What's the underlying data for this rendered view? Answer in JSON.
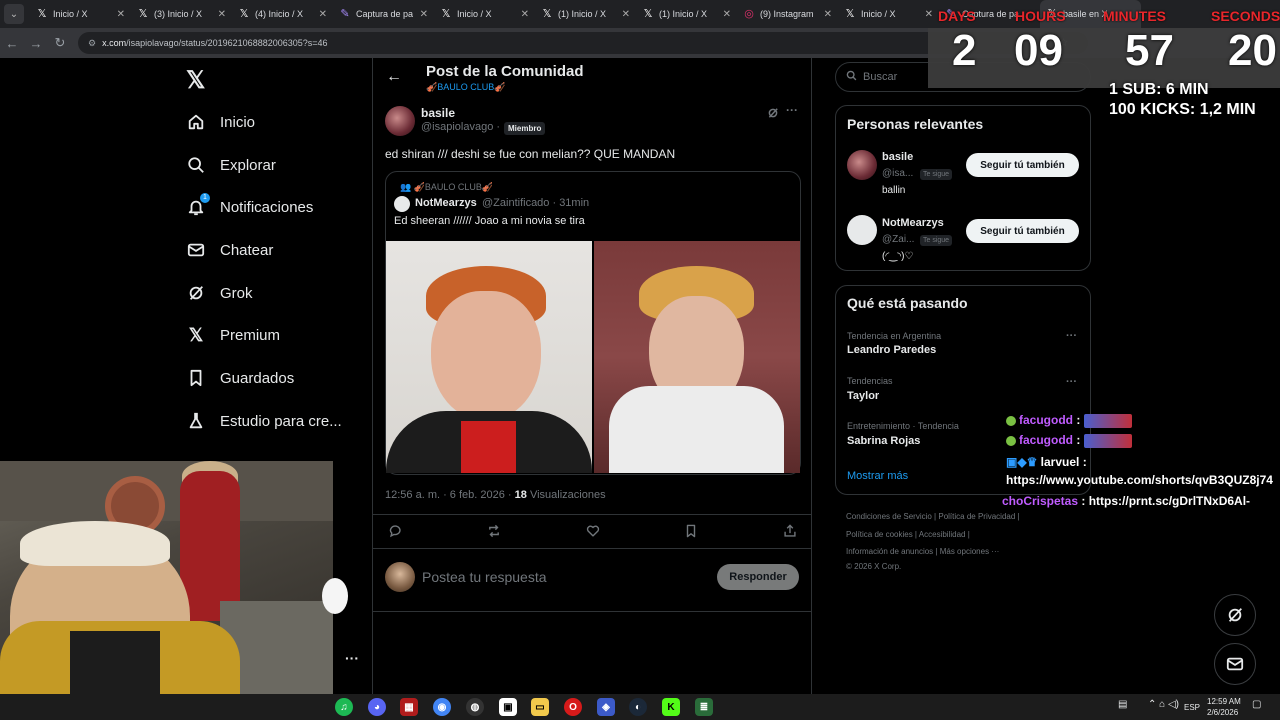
{
  "browser": {
    "tabs": [
      {
        "title": "Inicio / X",
        "icon": "x-icon"
      },
      {
        "title": "(3) Inicio / X",
        "icon": "x-icon"
      },
      {
        "title": "(4) Inicio / X",
        "icon": "x-icon"
      },
      {
        "title": "Captura de pa",
        "icon": "pen-icon"
      },
      {
        "title": "Inicio / X",
        "icon": "x-icon"
      },
      {
        "title": "(1) Inicio / X",
        "icon": "x-icon"
      },
      {
        "title": "(1) Inicio / X",
        "icon": "x-icon"
      },
      {
        "title": "(9) Instagram",
        "icon": "instagram-icon"
      },
      {
        "title": "Inicio / X",
        "icon": "x-icon"
      },
      {
        "title": "Captura de pa",
        "icon": "pen-icon"
      },
      {
        "title": "basile en X",
        "icon": "x-icon"
      }
    ],
    "url_host": "x.com",
    "url_path": "/isapiolavago/status/2019621068882006305?s=46"
  },
  "nav": {
    "items": [
      {
        "label": "Inicio",
        "icon": "home-icon"
      },
      {
        "label": "Explorar",
        "icon": "search-icon"
      },
      {
        "label": "Notificaciones",
        "icon": "bell-icon",
        "badge": "1"
      },
      {
        "label": "Chatear",
        "icon": "mail-icon"
      },
      {
        "label": "Grok",
        "icon": "grok-icon"
      },
      {
        "label": "Premium",
        "icon": "x-icon"
      },
      {
        "label": "Guardados",
        "icon": "bookmark-icon"
      },
      {
        "label": "Estudio para cre...",
        "icon": "studio-icon"
      }
    ],
    "more": "···"
  },
  "post": {
    "header_title": "Post de la Comunidad",
    "community": "🎻BAULO CLUB🎻",
    "author_name": "basile",
    "author_handle": "@isapiolavago",
    "member_tag": "Miembro",
    "text": "ed shiran /// deshi se fue con melian?? QUE MANDAN",
    "quote": {
      "community": "👥 🎻BAULO CLUB🎻",
      "name": "NotMearzys",
      "handle": "@Zaintificado · 31min",
      "text": "Ed sheeran  //////  Joao a mi novia se tira"
    },
    "time": "12:56 a. m. · 6 feb. 2026 · ",
    "views_count": "18",
    "views_label": " Visualizaciones",
    "reply_placeholder": "Postea tu respuesta",
    "reply_button": "Responder"
  },
  "sidebar": {
    "search_placeholder": "Buscar",
    "relevant_title": "Personas relevantes",
    "people": [
      {
        "name": "basile",
        "handle": "@isa...",
        "tag": "Te sigue",
        "bio": "ballin",
        "button": "Seguir tú también"
      },
      {
        "name": "NotMearzys",
        "handle": "@Zai...",
        "tag": "Te sigue",
        "bio": "(◜‿◝)♡",
        "button": "Seguir tú también"
      }
    ],
    "trends_title": "Qué está pasando",
    "trends": [
      {
        "meta": "Tendencia en Argentina",
        "name": "Leandro Paredes"
      },
      {
        "meta": "Tendencias",
        "name": "Taylor"
      },
      {
        "meta": "Entretenimiento · Tendencia",
        "name": "Sabrina Rojas"
      }
    ],
    "show_more": "Mostrar más",
    "footer": {
      "line1a": "Condiciones de Servicio",
      "line1b": "Política de Privacidad",
      "line2a": "Política de cookies",
      "line2b": "Accesibilidad",
      "line3a": "Información de anuncios",
      "line3b": "Más opciones ···",
      "line4": "© 2026 X Corp."
    }
  },
  "overlay": {
    "days_label": "DAYS",
    "hours_label": "HOURS",
    "minutes_label": "MINUTES",
    "seconds_label": "SECONDS",
    "days": "2",
    "hours": "09",
    "minutes": "57",
    "seconds": "20",
    "rule1": "1 SUB: 6 MIN",
    "rule2": "100 KICKS: 1,2 MIN",
    "chat": [
      {
        "user": "facugodd",
        "msg": ""
      },
      {
        "user": "facugodd",
        "msg": ""
      },
      {
        "user": "larvuel",
        "msg": ""
      },
      {
        "user": "",
        "msg": "https://www.youtube.com/shorts/qvB3QUZ8j74"
      },
      {
        "user": "choCrispetas",
        "msg": "https://prnt.sc/gDrlTNxD6Al-"
      }
    ]
  },
  "taskbar": {
    "lang": "ESP",
    "time": "12:59 AM",
    "date": "2/6/2026"
  }
}
